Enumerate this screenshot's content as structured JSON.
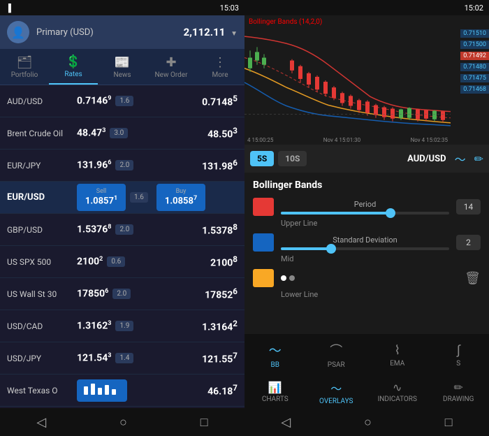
{
  "left": {
    "status_bar": {
      "time": "15:03",
      "icons": [
        "signal",
        "battery"
      ]
    },
    "account": {
      "name": "Primary (USD)",
      "balance": "2,112.11",
      "currency_symbol": "▼"
    },
    "nav_tabs": [
      {
        "id": "portfolio",
        "label": "Portfolio",
        "icon": "📊",
        "active": false
      },
      {
        "id": "rates",
        "label": "Rates",
        "icon": "💱",
        "active": true
      },
      {
        "id": "news",
        "label": "News",
        "icon": "📰",
        "active": false
      },
      {
        "id": "new_order",
        "label": "New Order",
        "icon": "✚",
        "active": false
      },
      {
        "id": "more",
        "label": "More",
        "icon": "⋮",
        "active": false
      }
    ],
    "market_rows": [
      {
        "name": "AUD/USD",
        "price1": "0.7146",
        "price1_sup": "9",
        "spread": "1.6",
        "price2": "0.7148",
        "price2_sup": "5",
        "bold": false
      },
      {
        "name": "Brent Crude Oil",
        "price1": "48.47",
        "price1_sup": "3",
        "spread": "3.0",
        "price2": "48.50",
        "price2_sup": "3",
        "bold": false
      },
      {
        "name": "EUR/JPY",
        "price1": "131.96",
        "price1_sup": "6",
        "spread": "2.0",
        "price2": "131.98",
        "price2_sup": "6",
        "bold": false
      },
      {
        "name": "EUR/USD",
        "sell_label": "Sell",
        "sell_price": "1.0857",
        "sell_sup": "1",
        "spread": "1.6",
        "buy_label": "Buy",
        "buy_price": "1.0858",
        "buy_sup": "7",
        "bold": true,
        "is_selected": true
      },
      {
        "name": "GBP/USD",
        "price1": "1.5376",
        "price1_sup": "8",
        "spread": "2.0",
        "price2": "1.5378",
        "price2_sup": "8",
        "bold": false
      },
      {
        "name": "US SPX 500",
        "price1": "2100",
        "price1_sup": "2",
        "spread": "0.6",
        "price2": "2100",
        "price2_sup": "8",
        "bold": false
      },
      {
        "name": "US Wall St 30",
        "price1": "17850",
        "price1_sup": "6",
        "spread": "2.0",
        "price2": "17852",
        "price2_sup": "6",
        "bold": false
      },
      {
        "name": "USD/CAD",
        "price1": "1.3162",
        "price1_sup": "3",
        "spread": "1.9",
        "price2": "1.3164",
        "price2_sup": "2",
        "bold": false
      },
      {
        "name": "USD/JPY",
        "price1": "121.54",
        "price1_sup": "3",
        "spread": "1.4",
        "price2": "121.55",
        "price2_sup": "7",
        "bold": false
      },
      {
        "name": "West Texas O",
        "price1": "46.18",
        "price1_sup": "7",
        "spread": "",
        "price2": "",
        "bold": false,
        "has_chart": true
      }
    ],
    "bottom_nav": [
      "◁",
      "○",
      "□"
    ]
  },
  "right": {
    "status_bar": {
      "time": "15:02",
      "icons": [
        "signal",
        "battery"
      ]
    },
    "chart": {
      "title": "Bollinger Bands (14,2,0)",
      "price_labels": [
        "0.71510",
        "0.71500",
        "0.71492",
        "0.71480",
        "0.71475",
        "0.71468"
      ],
      "time_labels": [
        "4 15:00:25",
        "Nov 4 15:01:30",
        "Nov 4 15:02:35"
      ]
    },
    "toolbar": {
      "time_buttons": [
        {
          "label": "5S",
          "active": true
        },
        {
          "label": "10S",
          "active": false
        }
      ],
      "pair": "AUD/USD",
      "icons": [
        "waveform",
        "pencil"
      ]
    },
    "bollinger_settings": {
      "title": "Bollinger Bands",
      "period_label": "Period",
      "period_value": "14",
      "period_fill_pct": 65,
      "deviation_label": "Standard Deviation",
      "deviation_value": "2",
      "deviation_fill_pct": 30,
      "lines": [
        {
          "color": "red",
          "label": "Upper Line"
        },
        {
          "color": "blue",
          "label": "Mid"
        },
        {
          "color": "yellow",
          "label": "Lower Line"
        }
      ]
    },
    "indicator_tabs": [
      {
        "id": "bb",
        "label": "BB",
        "icon": "〜",
        "active": true
      },
      {
        "id": "psar",
        "label": "PSAR",
        "icon": "⌒",
        "active": false
      },
      {
        "id": "ema",
        "label": "EMA",
        "icon": "⌇",
        "active": false
      },
      {
        "id": "s",
        "label": "S",
        "icon": "∫",
        "active": false
      }
    ],
    "bottom_tabs": [
      {
        "id": "charts",
        "label": "CHARTS",
        "icon": "📊",
        "active": false
      },
      {
        "id": "overlays",
        "label": "OVERLAYS",
        "icon": "〜",
        "active": true
      },
      {
        "id": "indicators",
        "label": "INDICATORS",
        "icon": "∿",
        "active": false
      },
      {
        "id": "drawing",
        "label": "DRAWING",
        "icon": "✏",
        "active": false
      }
    ],
    "bottom_nav": [
      "◁",
      "○",
      "□"
    ]
  }
}
